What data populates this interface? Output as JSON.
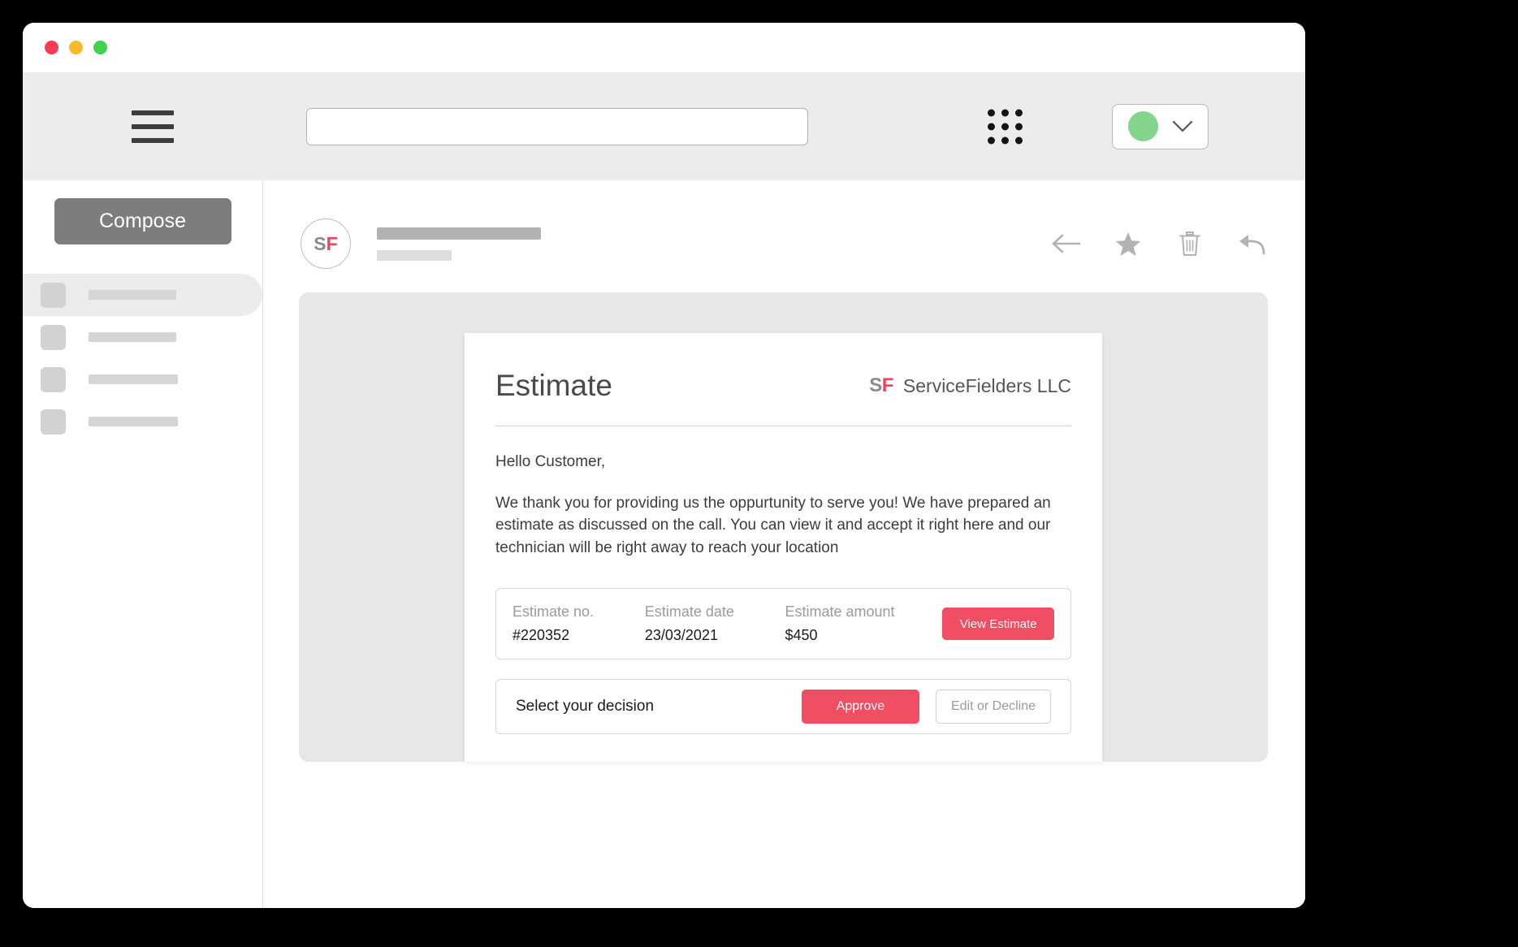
{
  "window": {
    "traffic_lights": [
      "close",
      "minimize",
      "maximize"
    ]
  },
  "header": {
    "menu_icon": "hamburger-menu-icon",
    "search": {
      "value": "",
      "placeholder": ""
    },
    "apps_icon": "grid-apps-icon",
    "profile": {
      "avatar_color": "#83d58c",
      "chevron_icon": "chevron-down-icon"
    }
  },
  "sidebar": {
    "compose_label": "Compose",
    "items": [
      {
        "label": "",
        "active": true
      },
      {
        "label": "",
        "active": false
      },
      {
        "label": "",
        "active": false
      },
      {
        "label": "",
        "active": false
      }
    ]
  },
  "mail": {
    "sender_initials": {
      "first": "S",
      "second": "F"
    },
    "subject_placeholder": "",
    "meta_placeholder": "",
    "actions": [
      {
        "name": "back-icon",
        "label": "Back"
      },
      {
        "name": "star-icon",
        "label": "Star"
      },
      {
        "name": "trash-icon",
        "label": "Delete"
      },
      {
        "name": "reply-icon",
        "label": "Reply"
      }
    ]
  },
  "estimate": {
    "title": "Estimate",
    "brand_mark_s": "S",
    "brand_mark_f": "F",
    "brand_name": "ServiceFielders LLC",
    "greeting": "Hello Customer,",
    "paragraph": "We thank you for providing us the oppurtunity to serve you! We have prepared an estimate as discussed on the call. You can view it and accept it right here and our technician will be right away to reach your location",
    "details": [
      {
        "label": "Estimate no.",
        "value": "#220352"
      },
      {
        "label": "Estimate date",
        "value": "23/03/2021"
      },
      {
        "label": "Estimate amount",
        "value": "$450"
      }
    ],
    "view_estimate_label": "View Estimate",
    "decision_label": "Select your decision",
    "approve_label": "Approve",
    "decline_label": "Edit or Decline"
  },
  "colors": {
    "accent": "#ef4e63",
    "brand_gray": "#8a8a8a",
    "avatar_green": "#83d58c",
    "header_bg": "#ececec",
    "panel_bg": "#e7e7e7"
  }
}
